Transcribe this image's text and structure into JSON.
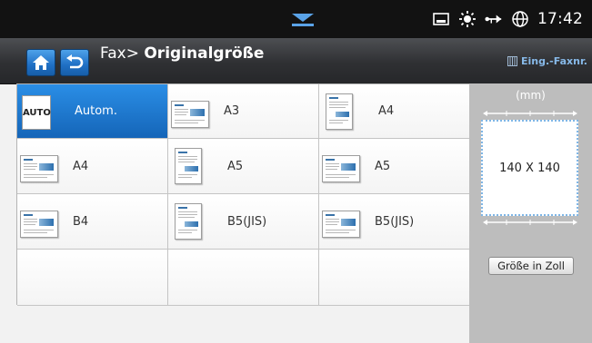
{
  "status": {
    "time": "17:42",
    "icons": [
      "tray-icon",
      "sun-icon",
      "network-icon",
      "globe-icon"
    ]
  },
  "header": {
    "breadcrumb": "Fax>",
    "title": "Originalgröße",
    "fax_number_label": "Eing.-Faxnr."
  },
  "options": [
    {
      "label": "Autom.",
      "thumb": "AUTO",
      "orientation": "auto",
      "selected": true
    },
    {
      "label": "A3",
      "orientation": "landscape",
      "selected": false
    },
    {
      "label": "A4",
      "orientation": "portrait",
      "selected": false
    },
    {
      "label": "A4",
      "orientation": "landscape",
      "selected": false
    },
    {
      "label": "A5",
      "orientation": "portrait",
      "selected": false
    },
    {
      "label": "A5",
      "orientation": "landscape",
      "selected": false
    },
    {
      "label": "B4",
      "orientation": "landscape",
      "selected": false
    },
    {
      "label": "B5(JIS)",
      "orientation": "portrait",
      "selected": false
    },
    {
      "label": "B5(JIS)",
      "orientation": "landscape",
      "selected": false
    }
  ],
  "size_panel": {
    "unit": "(mm)",
    "value": "140 X 140",
    "inch_button_label": "Größe in Zoll"
  },
  "colors": {
    "selected": "#1a72c8",
    "status_bar": "#121212",
    "title_bar": "#2f3033"
  }
}
